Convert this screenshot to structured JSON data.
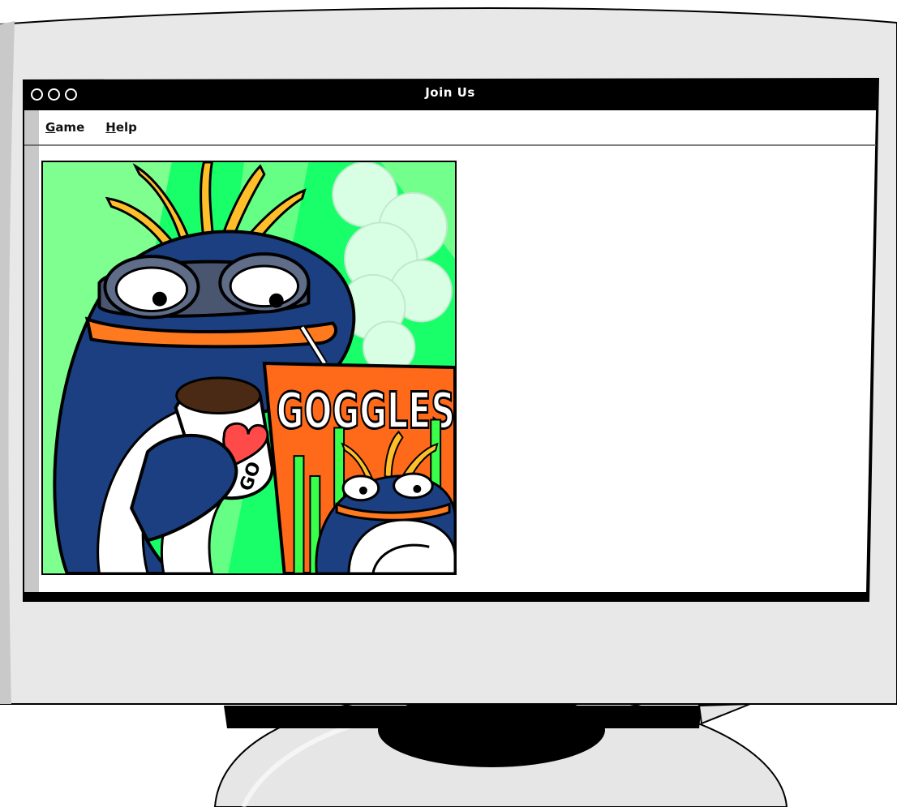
{
  "window": {
    "title": "Join Us",
    "controls": [
      "close",
      "minimize",
      "maximize"
    ]
  },
  "menu": {
    "items": [
      {
        "accel": "G",
        "rest": "ame"
      },
      {
        "accel": "H",
        "rest": "elp"
      }
    ]
  },
  "artwork": {
    "sign_text": "GOGGLES",
    "mug_text": "GO"
  },
  "colors": {
    "bezel": "#e8e8e8",
    "titlebar": "#000000",
    "art_bg": "#18ff6a",
    "character_body": "#1b3f80",
    "accent_orange": "#ff7a1f",
    "heart": "#ff4a4a"
  }
}
